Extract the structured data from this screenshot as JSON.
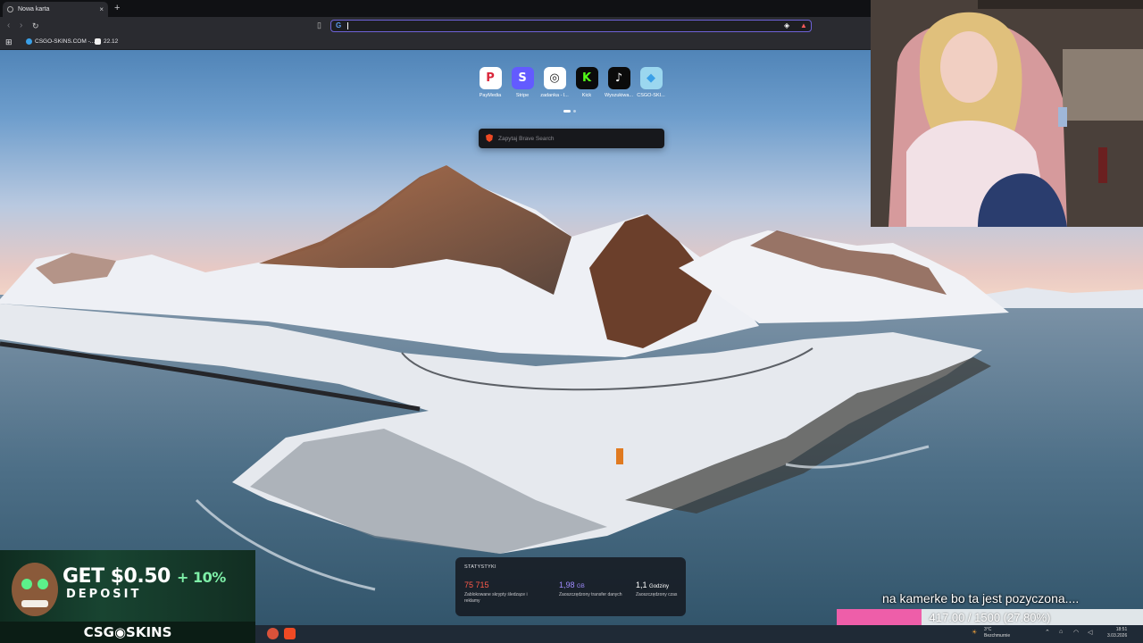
{
  "browser": {
    "tab_title": "Nowa karta",
    "tab_close": "×",
    "new_tab": "+",
    "url_value": "",
    "bookmarks": [
      {
        "label": "CSGO-SKINS.COM -...",
        "color": "#3aa0e8"
      },
      {
        "label": "22.12",
        "color": "#f0f0f0"
      }
    ]
  },
  "top_sites": [
    {
      "label": "PayMedia",
      "glyph": "P",
      "bg": "#ffffff",
      "fg": "#d9263a"
    },
    {
      "label": "Stripe",
      "glyph": "S",
      "bg": "#635bff",
      "fg": "#ffffff"
    },
    {
      "label": "zadanka - l...",
      "glyph": "◎",
      "bg": "#ffffff",
      "fg": "#222222"
    },
    {
      "label": "Kick",
      "glyph": "K",
      "bg": "#0b0b0b",
      "fg": "#53fc18"
    },
    {
      "label": "Wyszukiwa...",
      "glyph": "♪",
      "bg": "#0b0b0b",
      "fg": "#ffffff"
    },
    {
      "label": "CSGO-SKI...",
      "glyph": "◆",
      "bg": "#9bd7ef",
      "fg": "#3aa0e8"
    }
  ],
  "search": {
    "placeholder": "Zapytaj Brave Search"
  },
  "stats": {
    "heading": "STATYSTYKI",
    "items": [
      {
        "value": "75 715",
        "unit": "",
        "desc": "Zablokowane skrypty śledzące i reklamy",
        "color": "#ff5a4a"
      },
      {
        "value": "1,98",
        "unit": "GB",
        "desc": "Zaoszczędzony transfer danych",
        "color": "#a08cff"
      },
      {
        "value": "1,1",
        "unit": "Godziny",
        "desc": "Zaoszczędzony czas",
        "color": "#ffffff"
      }
    ]
  },
  "ad": {
    "headline_amount": "GET $0.50",
    "headline_plus": "+ 10%",
    "headline_sub": "DEPOSIT",
    "brand": "CSG◉SKINS"
  },
  "overlay": {
    "caption": "na kamerke bo ta jest pozyczona....",
    "goal_text": "417.00 / 1500 (27.80%)",
    "goal_fraction": 0.278,
    "goal_color": "#ee5ea9"
  },
  "taskbar": {
    "weather_temp": "3°C",
    "weather_desc": "Bezchmurnie",
    "time": "18:51",
    "date": "3.03.2026"
  }
}
